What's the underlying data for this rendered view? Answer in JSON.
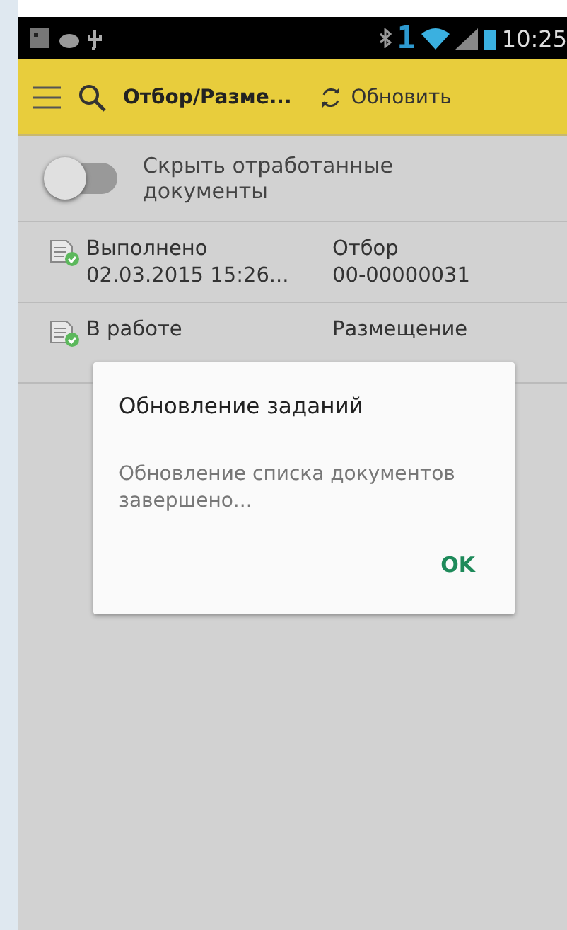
{
  "status_bar": {
    "network_digit": "1",
    "time": "10:25"
  },
  "toolbar": {
    "title": "Отбор/Разме...",
    "refresh_label": "Обновить"
  },
  "toggle": {
    "label": "Скрыть отработанные документы",
    "checked": false
  },
  "documents": [
    {
      "status": "Выполнено",
      "date": "02.03.2015 15:26...",
      "type": "Отбор",
      "number": "00-00000031"
    },
    {
      "status": "В работе",
      "type": "Размещение"
    }
  ],
  "dialog": {
    "title": "Обновление заданий",
    "message": "Обновление списка документов завершено...",
    "button": "OK"
  }
}
